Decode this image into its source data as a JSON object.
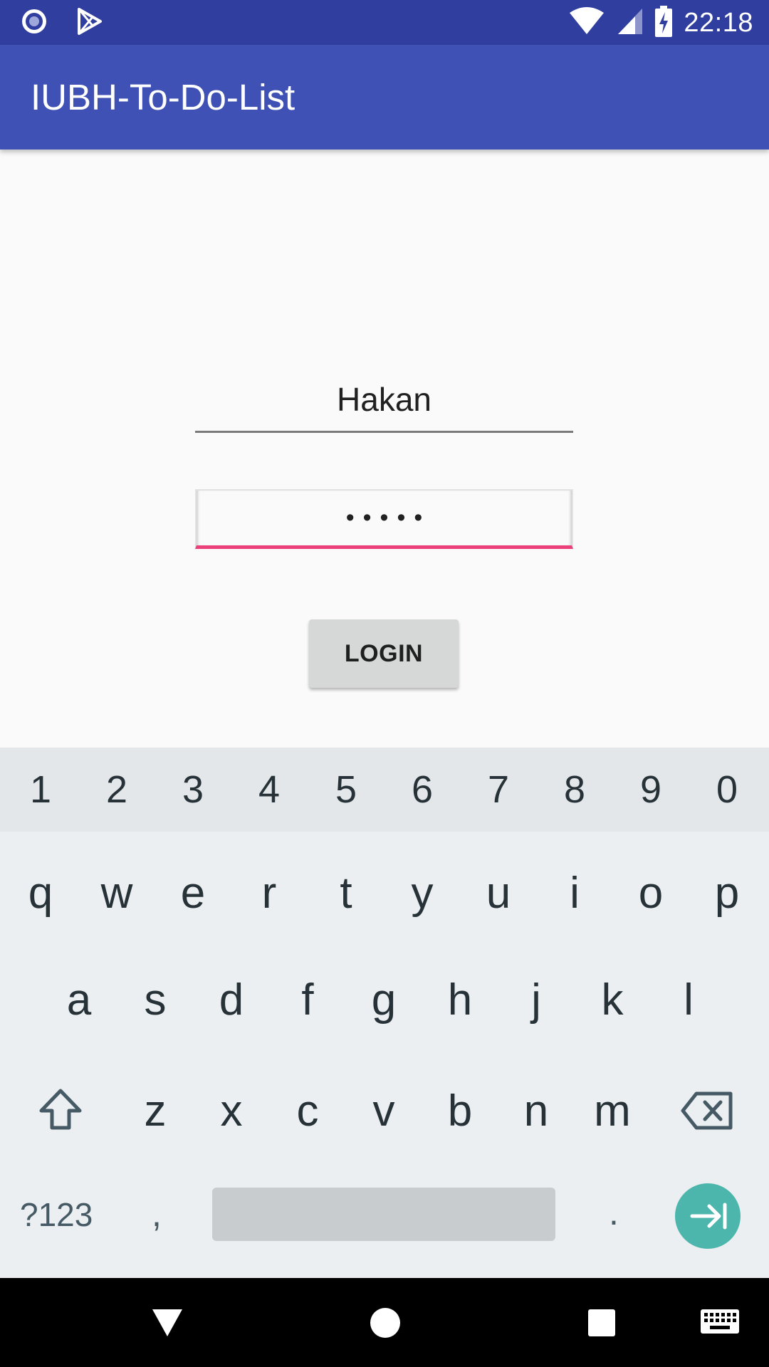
{
  "status_bar": {
    "time": "22:18",
    "icons": [
      "notification-circle-icon",
      "play-store-icon",
      "wifi-icon",
      "signal-icon",
      "battery-charging-icon"
    ]
  },
  "app_bar": {
    "title": "IUBH-To-Do-List"
  },
  "login_form": {
    "username_value": "Hakan",
    "password_value": "•••••",
    "login_label": "LOGIN"
  },
  "colors": {
    "status_bar": "#303f9f",
    "app_bar": "#3f51b5",
    "accent": "#ec407a",
    "keyboard_action": "#4db6ac"
  },
  "keyboard": {
    "numbers": [
      "1",
      "2",
      "3",
      "4",
      "5",
      "6",
      "7",
      "8",
      "9",
      "0"
    ],
    "row1": [
      "q",
      "w",
      "e",
      "r",
      "t",
      "y",
      "u",
      "i",
      "o",
      "p"
    ],
    "row2": [
      "a",
      "s",
      "d",
      "f",
      "g",
      "h",
      "j",
      "k",
      "l"
    ],
    "row3": [
      "z",
      "x",
      "c",
      "v",
      "b",
      "n",
      "m"
    ],
    "symbols_label": "?123",
    "comma": ",",
    "period": ".",
    "icons": [
      "shift-icon",
      "backspace-icon",
      "next-field-icon"
    ]
  },
  "nav_bar": {
    "icons": [
      "back-icon",
      "home-icon",
      "recents-icon",
      "keyboard-icon"
    ]
  }
}
